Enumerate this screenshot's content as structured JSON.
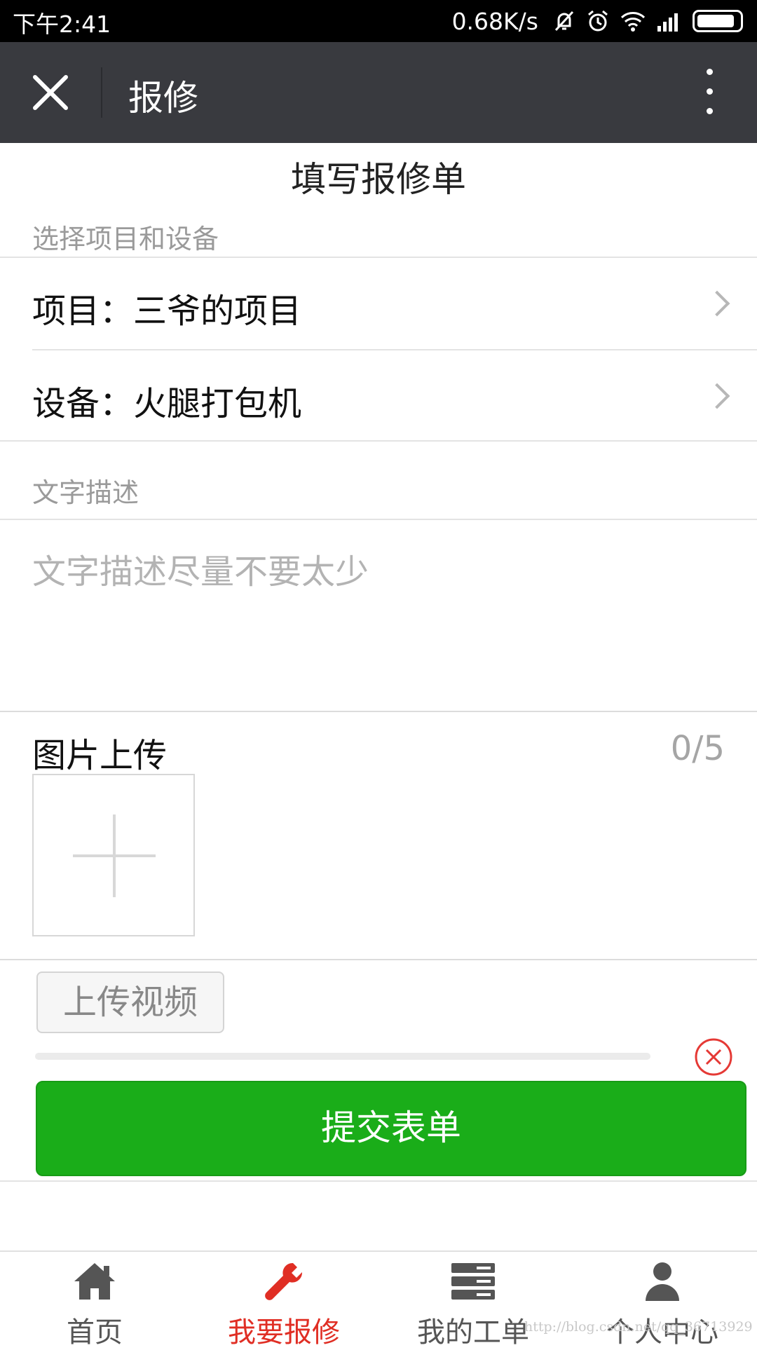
{
  "status_bar": {
    "time": "下午2:41",
    "net_speed": "0.68K/s",
    "icons": [
      "mute-icon",
      "alarm-icon",
      "wifi-icon",
      "signal-icon",
      "battery-icon"
    ]
  },
  "title_bar": {
    "title": "报修",
    "close_icon": "close-icon",
    "menu_icon": "more-vertical-icon"
  },
  "form": {
    "title": "填写报修单",
    "select_section_label": "选择项目和设备",
    "project_row": "项目：三爷的项目",
    "device_row": "设备：火腿打包机",
    "desc_section_label": "文字描述",
    "desc_placeholder": "文字描述尽量不要太少",
    "image_upload_label": "图片上传",
    "image_count": "0/5",
    "upload_video_label": "上传视频",
    "video_progress": 0,
    "submit_label": "提交表单"
  },
  "bottom_nav": {
    "items": [
      {
        "label": "首页",
        "icon": "home-icon",
        "active": false
      },
      {
        "label": "我要报修",
        "icon": "wrench-icon",
        "active": true
      },
      {
        "label": "我的工单",
        "icon": "list-icon",
        "active": false
      },
      {
        "label": "个人中心",
        "icon": "user-icon",
        "active": false
      }
    ]
  },
  "watermark": "http://blog.csdn.net/qq_36713929",
  "colors": {
    "title_bar_bg": "#393a3f",
    "primary_green": "#1aad19",
    "active_red": "#e02e24",
    "cancel_red": "#e53935"
  }
}
